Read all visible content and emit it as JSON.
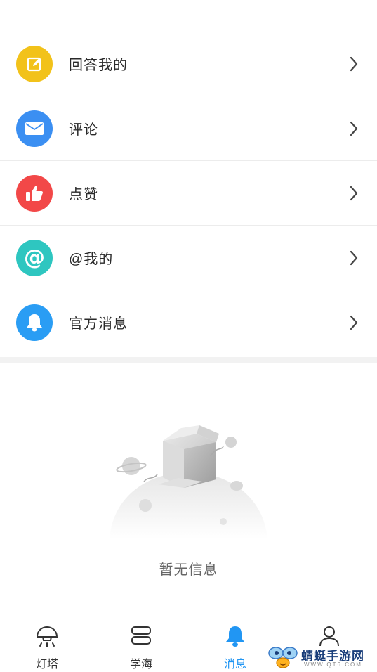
{
  "menu": {
    "items": [
      {
        "label": "回答我的",
        "icon": "edit-icon",
        "color": "#f2c21a"
      },
      {
        "label": "评论",
        "icon": "mail-icon",
        "color": "#3b8ff2"
      },
      {
        "label": "点赞",
        "icon": "thumbs-up-icon",
        "color": "#f24848"
      },
      {
        "label": "@我的",
        "icon": "at-icon",
        "color": "#2ec6c0"
      },
      {
        "label": "官方消息",
        "icon": "bell-icon",
        "color": "#2a9df4"
      }
    ]
  },
  "empty_state": {
    "message": "暂无信息"
  },
  "tabbar": {
    "tabs": [
      {
        "label": "灯塔",
        "icon": "lamp-icon"
      },
      {
        "label": "学海",
        "icon": "books-icon"
      },
      {
        "label": "消息",
        "icon": "bell-icon",
        "active": true
      },
      {
        "label": "",
        "icon": "user-icon"
      }
    ],
    "active_color": "#2196f3"
  },
  "watermark": {
    "title": "蜻蜓手游网",
    "url": "WWW.QT6.COM"
  }
}
